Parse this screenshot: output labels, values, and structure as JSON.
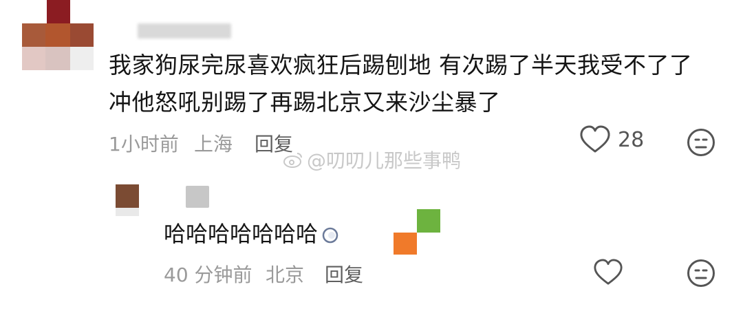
{
  "comments": [
    {
      "text_line1": "我家狗尿完尿喜欢疯狂后踢刨地 有次踢了半天我受不了了",
      "text_line2": "冲他怒吼别踢了再踢北京又来沙尘暴了",
      "time": "1小时前",
      "location": "上海",
      "reply_label": "回复",
      "like_count": "28"
    },
    {
      "text": "哈哈哈哈哈哈哈",
      "time": "40 分钟前",
      "location": "北京",
      "reply_label": "回复"
    }
  ],
  "watermark": "@叨叨儿那些事鸭",
  "icons": {
    "like": "heart-outline-icon",
    "dislike": "meh-face-icon",
    "watermark_logo": "weibo-logo-icon"
  },
  "colors": {
    "meta_gray": "#9a9a9a",
    "icon_gray": "#555555",
    "mosaic_orange": "#f07a2a",
    "mosaic_green": "#6db33f"
  }
}
